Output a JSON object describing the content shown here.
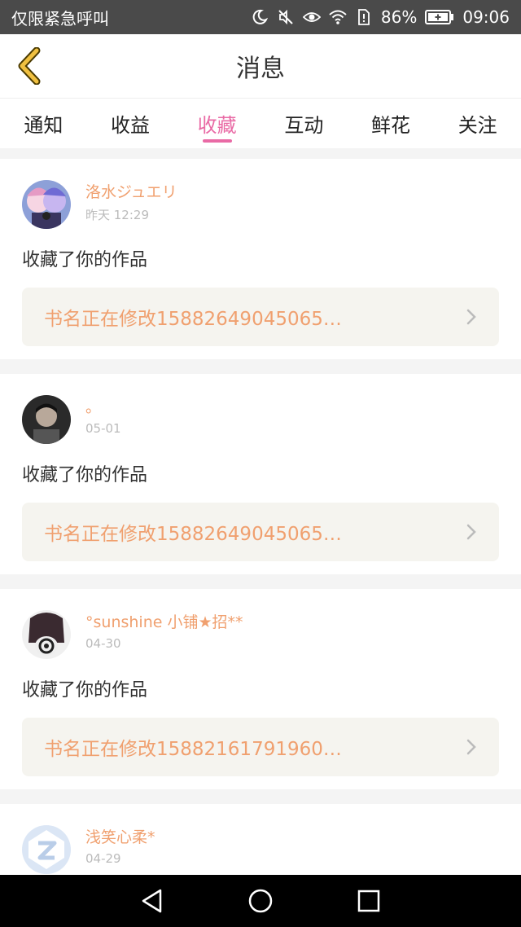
{
  "status_bar": {
    "left_text": "仅限紧急呼叫",
    "battery": "86%",
    "time": "09:06",
    "icons": [
      "moon-icon",
      "mute-icon",
      "eye-icon",
      "wifi-icon",
      "sim-icon",
      "battery-icon"
    ]
  },
  "header": {
    "title": "消息"
  },
  "tabs": [
    {
      "label": "通知",
      "active": false
    },
    {
      "label": "收益",
      "active": false
    },
    {
      "label": "收藏",
      "active": true
    },
    {
      "label": "互动",
      "active": false
    },
    {
      "label": "鲜花",
      "active": false
    },
    {
      "label": "关注",
      "active": false
    }
  ],
  "messages": [
    {
      "username": "洛水ジュエリ",
      "time": "昨天 12:29",
      "action": "收藏了你的作品",
      "book": "书名正在修改15882649045065…",
      "avatar": "anime-avatar"
    },
    {
      "username": "。",
      "time": "05-01",
      "action": "收藏了你的作品",
      "book": "书名正在修改15882649045065…",
      "avatar": "portrait-avatar"
    },
    {
      "username": "°sunshine 小铺★招**",
      "time": "04-30",
      "action": "收藏了你的作品",
      "book": "书名正在修改15882161791960…",
      "avatar": "logo-avatar"
    },
    {
      "username": "浅笑心柔*",
      "time": "04-29",
      "avatar": "default-avatar"
    }
  ],
  "colors": {
    "accent": "#e96aa5",
    "username": "#f0a06f",
    "back_arrow": "#f0c040"
  }
}
